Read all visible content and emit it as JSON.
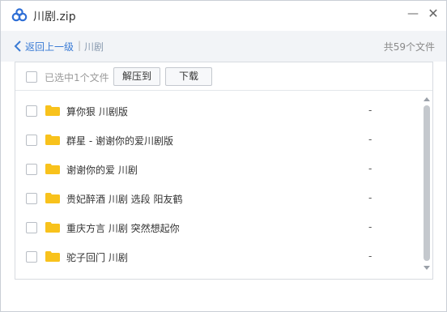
{
  "window": {
    "title": "川剧.zip",
    "minimize_glyph": "—",
    "close_glyph": "✕"
  },
  "nav": {
    "back_label": "返回上一级",
    "separator": "|",
    "crumb": "川剧",
    "file_count": "共59个文件"
  },
  "toolbar": {
    "selected_text": "已选中1个文件",
    "extract_label": "解压到",
    "download_label": "下载"
  },
  "files": [
    {
      "name": "算你狠 川剧版",
      "size": "-"
    },
    {
      "name": "群星 - 谢谢你的爱川剧版",
      "size": "-"
    },
    {
      "name": "谢谢你的爱 川剧",
      "size": "-"
    },
    {
      "name": "贵妃醉酒 川剧 选段 阳友鹤",
      "size": "-"
    },
    {
      "name": "重庆方言 川剧 突然想起你",
      "size": "-"
    },
    {
      "name": "驼子回门 川剧",
      "size": "-"
    }
  ],
  "colors": {
    "accent": "#3a7bd5",
    "folder": "#f8c21c",
    "logo": "#2f6fd6"
  },
  "icons": {
    "logo": "baidu-netdisk-logo-icon",
    "back": "chevron-left-icon",
    "folder": "folder-icon"
  }
}
